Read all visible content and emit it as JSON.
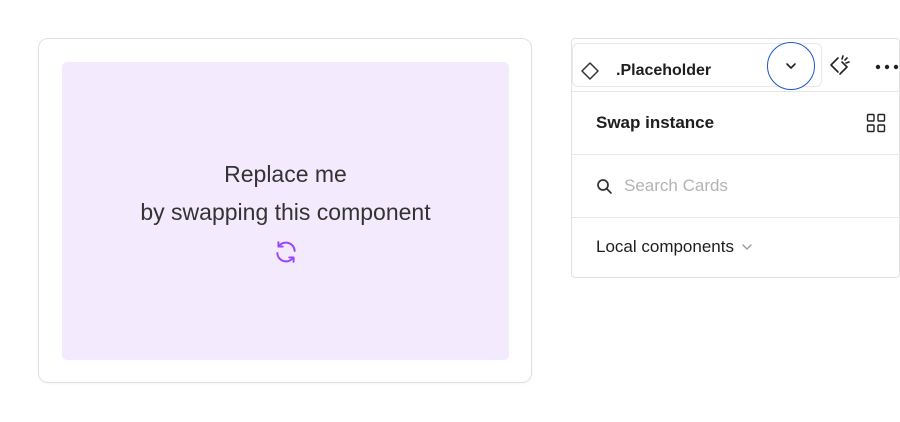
{
  "placeholder_card": {
    "line1": "Replace me",
    "line2": "by swapping this component",
    "background": "#f3eafd",
    "icon": "refresh-icon",
    "icon_color": "#9747ff"
  },
  "instance_panel": {
    "component_name": ".Placeholder",
    "component_icon": "diamond-icon",
    "dropdown_icon": "chevron-down-icon",
    "detach_icon": "detach-instance-icon",
    "more_icon": "more-horizontal-icon",
    "focus_ring_color": "#1f57c4",
    "swap": {
      "title": "Swap instance",
      "view_icon": "grid-view-icon",
      "search_placeholder": "Search Cards",
      "search_value": "",
      "library_label": "Local components"
    }
  }
}
